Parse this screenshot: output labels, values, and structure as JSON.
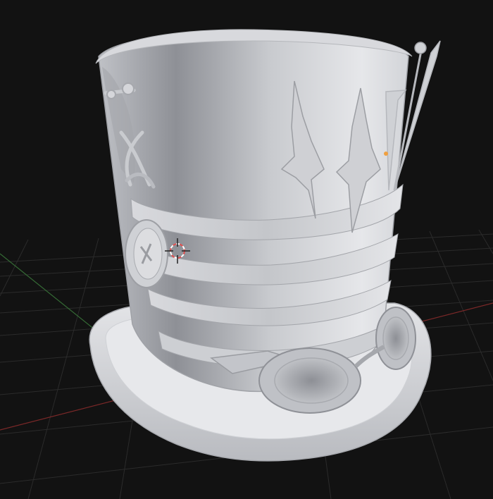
{
  "viewport": {
    "colors": {
      "background": "#121212",
      "grid": "#2a2a2a",
      "x_axis": "#8a2a2a",
      "y_axis": "#3f7a3f",
      "model": "#d9dade",
      "model_shade": "#9a9ca2",
      "origin_dot": "#f0a040"
    },
    "cursor_icon": "3d-cursor-icon",
    "model_name": "steampunk-top-hat"
  }
}
